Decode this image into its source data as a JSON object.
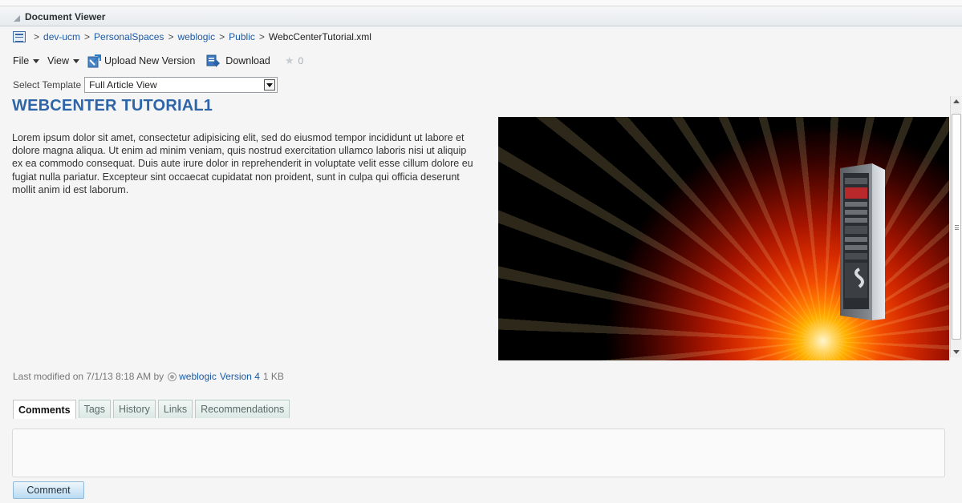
{
  "panel": {
    "title": "Document Viewer"
  },
  "breadcrumb": {
    "items": [
      {
        "label": "dev-ucm",
        "link": true
      },
      {
        "label": "PersonalSpaces",
        "link": true
      },
      {
        "label": "weblogic",
        "link": true
      },
      {
        "label": "Public",
        "link": true
      },
      {
        "label": "WebcCenterTutorial.xml",
        "link": false
      }
    ],
    "separator": ">"
  },
  "toolbar": {
    "file_label": "File",
    "view_label": "View",
    "upload_label": "Upload New Version",
    "download_label": "Download",
    "rating_count": "0"
  },
  "template": {
    "label": "Select Template",
    "selected": "Full Article View"
  },
  "article": {
    "title": "WEBCENTER TUTORIAL1",
    "body": "Lorem ipsum dolor sit amet, consectetur adipisicing elit, sed do eiusmod tempor incididunt ut labore et dolore magna aliqua. Ut enim ad minim veniam, quis nostrud exercitation ullamco laboris nisi ut aliquip ex ea commodo consequat. Duis aute irure dolor in reprehenderit in voluptate velit esse cillum dolore eu fugiat nulla pariatur. Excepteur sint occaecat cupidatat non proident, sunt in culpa qui officia deserunt mollit anim id est laborum."
  },
  "meta": {
    "modified_prefix": "Last modified on 7/1/13 8:18 AM  by",
    "user": "weblogic",
    "version": "Version 4",
    "size": "1 KB"
  },
  "tabs": [
    "Comments",
    "Tags",
    "History",
    "Links",
    "Recommendations"
  ],
  "active_tab": "Comments",
  "comment_button": "Comment",
  "colors": {
    "link": "#1c5aa6",
    "title": "#2d65a8",
    "button_bg": "#b9dbf2"
  },
  "icons": {
    "breadcrumb": "folder-view-icon",
    "upload": "upload-icon",
    "download": "download-icon",
    "rating": "star-icon",
    "user": "user-presence-icon"
  }
}
